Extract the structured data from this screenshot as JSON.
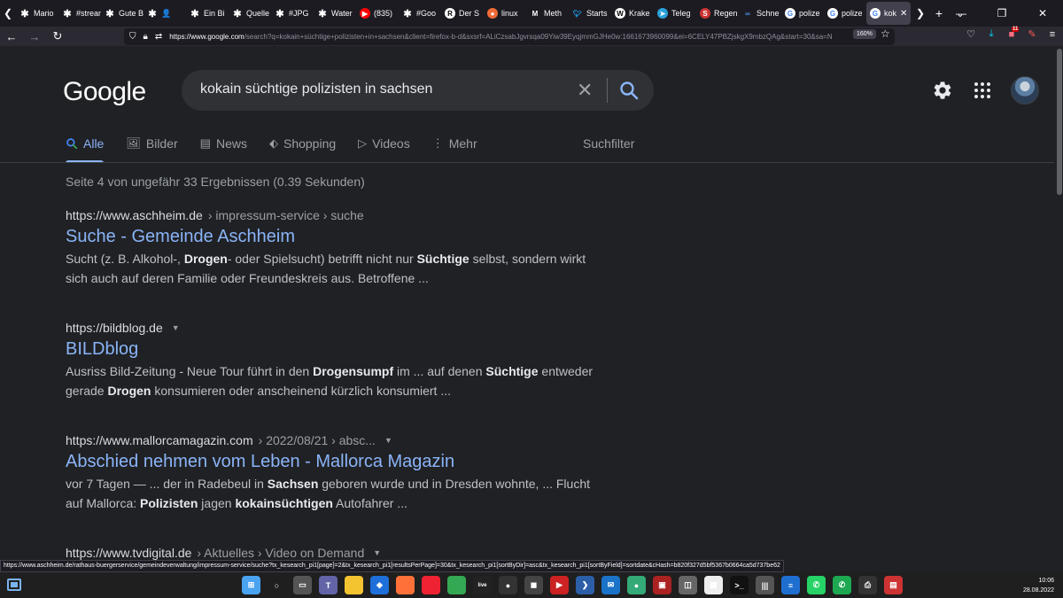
{
  "browser": {
    "tabs": [
      {
        "label": "Mario",
        "fav": "gear"
      },
      {
        "label": "#stream",
        "fav": "gear"
      },
      {
        "label": "Gute B",
        "fav": "gear"
      },
      {
        "label": "👤 ",
        "fav": "gear"
      },
      {
        "label": "Ein Bi",
        "fav": "gear"
      },
      {
        "label": "Quelle",
        "fav": "gear"
      },
      {
        "label": "#JPG",
        "fav": "gear"
      },
      {
        "label": "Water",
        "fav": "gear"
      },
      {
        "label": "(835)",
        "fav": "youtube"
      },
      {
        "label": "#Goo",
        "fav": "gear"
      },
      {
        "label": "Der S",
        "fav": "r"
      },
      {
        "label": "linux",
        "fav": "orange"
      },
      {
        "label": "Meth",
        "fav": "m"
      },
      {
        "label": "Starts",
        "fav": "twitter"
      },
      {
        "label": "Krake",
        "fav": "w"
      },
      {
        "label": "Teleg",
        "fav": "telegram"
      },
      {
        "label": "Regen",
        "fav": "s"
      },
      {
        "label": "Schne",
        "fav": "infinity"
      },
      {
        "label": "polize",
        "fav": "google"
      },
      {
        "label": "polize",
        "fav": "google"
      },
      {
        "label": "kok",
        "fav": "google",
        "active": true
      }
    ],
    "url_host": "https://www.google.com",
    "url_rest": "/search?q=kokain+süchtige+polizisten+in+sachsen&client=firefox-b-d&sxsrf=ALiCzsabJgvrsqa09Yiw39EyqjmmGJHe0w:1661673960099&ei=6CELY47PBZjskgX9mbzQAg&start=30&sa=N",
    "zoom": "160%",
    "status_url": "https://www.aschheim.de/rathaus-buergerservice/gemeindeverwaltung/impressum-service/suche?tx_kesearch_pi1[page]=2&tx_kesearch_pi1[resultsPerPage]=30&tx_kesearch_pi1[sortByDir]=asc&tx_kesearch_pi1[sortByField]=sortdate&cHash=b820f327d5bf5367b0664ca5d737be62",
    "ext_badge": "11"
  },
  "google": {
    "logo": "Google",
    "query": "kokain süchtige polizisten in sachsen",
    "nav": {
      "all": "Alle",
      "images": "Bilder",
      "news": "News",
      "shopping": "Shopping",
      "videos": "Videos",
      "more": "Mehr",
      "filter": "Suchfilter"
    },
    "stats": "Seite 4 von ungefähr 33 Ergebnissen (0.39 Sekunden)",
    "results": [
      {
        "host": "https://www.aschheim.de",
        "path": "› impressum-service › suche",
        "caret": false,
        "title": "Suche - Gemeinde Aschheim",
        "snippet_html": "Sucht (z. B. Alkohol-, <b>Drogen</b>- oder Spielsucht) betrifft nicht nur <b>Süchtige</b> selbst, sondern wirkt sich auch auf deren Familie oder Freundeskreis aus. Betroffene ..."
      },
      {
        "host": "https://bildblog.de",
        "path": "",
        "caret": true,
        "title": "BILDblog",
        "snippet_html": "Ausriss Bild-Zeitung - Neue Tour führt in den <b>Drogensumpf</b> im ... auf denen <b>Süchtige</b> entweder gerade <b>Drogen</b> konsumieren oder anscheinend kürzlich konsumiert ..."
      },
      {
        "host": "https://www.mallorcamagazin.com",
        "path": "› 2022/08/21 › absc...",
        "caret": true,
        "title": "Abschied nehmen vom Leben - Mallorca Magazin",
        "snippet_html": "vor 7 Tagen — ... der in Radebeul in <b>Sachsen</b> geboren wurde und in Dresden wohnte, ... Flucht auf Mallorca: <b>Polizisten</b> jagen <b>kokainsüchtigen</b> Autofahrer ..."
      },
      {
        "host": "https://www.tvdigital.de",
        "path": "› Aktuelles › Video on Demand",
        "caret": true,
        "title": "",
        "snippet_html": ""
      }
    ]
  },
  "taskbar": {
    "time": "10:06",
    "date": "28.08.2022",
    "apps": [
      {
        "name": "start",
        "color": "#4aa3f0",
        "glyph": "⊞"
      },
      {
        "name": "search",
        "color": "transparent",
        "glyph": "○"
      },
      {
        "name": "task-view",
        "color": "#555",
        "glyph": "▭"
      },
      {
        "name": "teams",
        "color": "#6264a7",
        "glyph": "T"
      },
      {
        "name": "explorer",
        "color": "#f4c430",
        "glyph": ""
      },
      {
        "name": "defender",
        "color": "#1e6fd9",
        "glyph": "◆"
      },
      {
        "name": "firefox",
        "color": "#ff7139",
        "glyph": ""
      },
      {
        "name": "firefox-dev",
        "color": "#e23",
        "glyph": ""
      },
      {
        "name": "chrome",
        "color": "#34a853",
        "glyph": ""
      },
      {
        "name": "live",
        "color": "#222",
        "glyph": "live"
      },
      {
        "name": "obs",
        "color": "#333",
        "glyph": "●"
      },
      {
        "name": "app-1",
        "color": "#444",
        "glyph": "◼"
      },
      {
        "name": "app-2",
        "color": "#c22",
        "glyph": "▶"
      },
      {
        "name": "terminal-blue",
        "color": "#2c5fa8",
        "glyph": "❯"
      },
      {
        "name": "mail",
        "color": "#1a73c8",
        "glyph": "✉"
      },
      {
        "name": "app-3",
        "color": "#3a7",
        "glyph": "●"
      },
      {
        "name": "app-4",
        "color": "#a22",
        "glyph": "▣"
      },
      {
        "name": "app-5",
        "color": "#666",
        "glyph": "◫"
      },
      {
        "name": "app-6",
        "color": "#eee",
        "glyph": "▦"
      },
      {
        "name": "terminal",
        "color": "#111",
        "glyph": ">_"
      },
      {
        "name": "library",
        "color": "#555",
        "glyph": "|||"
      },
      {
        "name": "notes",
        "color": "#1f6fd0",
        "glyph": "≡"
      },
      {
        "name": "whatsapp",
        "color": "#25d366",
        "glyph": "✆"
      },
      {
        "name": "whatsapp-2",
        "color": "#1da851",
        "glyph": "✆"
      },
      {
        "name": "app-7",
        "color": "#333",
        "glyph": "⎙"
      },
      {
        "name": "app-8",
        "color": "#c33",
        "glyph": "▤"
      }
    ]
  },
  "colors": {
    "link": "#8ab4f8",
    "bg": "#202124"
  }
}
